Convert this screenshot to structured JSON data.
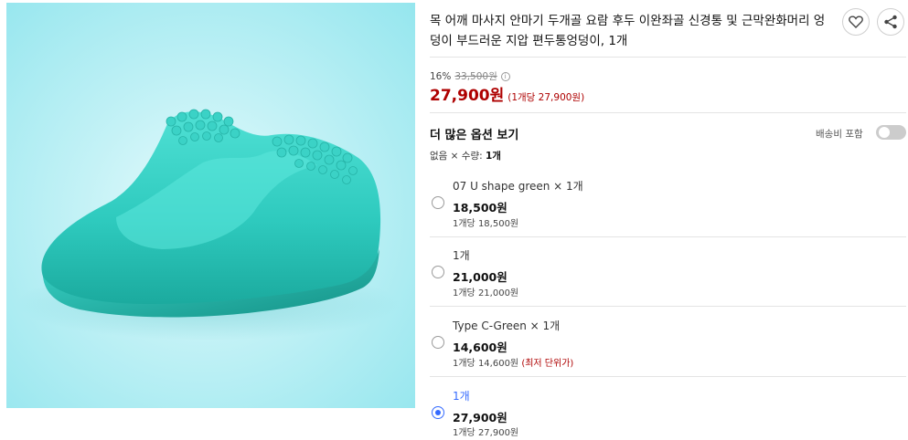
{
  "product": {
    "title": "목 어깨 마사지 안마기 두개골 요람 후두 이완좌골 신경통 및 근막완화머리 엉덩이 부드러운 지압 편두통엉덩이, 1개",
    "image_alt": "청록색 지압 마사지 베개"
  },
  "actions": {
    "wishlist_icon": "heart-icon",
    "share_icon": "share-icon"
  },
  "price": {
    "discount_rate": "16%",
    "original_price": "33,500원",
    "final_price": "27,900원",
    "unit_price": "(1개당 27,900원)"
  },
  "options_section": {
    "title": "더 많은 옵션 보기",
    "shipping_toggle_label": "배송비 포함",
    "shipping_toggle_on": false,
    "filter_prefix": "없음 × 수량:",
    "filter_value": "1개"
  },
  "options": [
    {
      "name": "07 U shape green × 1개",
      "price": "18,500원",
      "unit": "1개당 18,500원",
      "note": "",
      "selected": false
    },
    {
      "name": "1개",
      "price": "21,000원",
      "unit": "1개당 21,000원",
      "note": "",
      "selected": false
    },
    {
      "name": "Type C-Green × 1개",
      "price": "14,600원",
      "unit": "1개당 14,600원",
      "note": "(최저 단위가)",
      "selected": false
    },
    {
      "name": "1개",
      "price": "27,900원",
      "unit": "1개당 27,900원",
      "note": "",
      "selected": true
    }
  ],
  "colors": {
    "accent_blue": "#346aff",
    "price_red": "#ae0000",
    "product_teal": "#2fc9be"
  }
}
